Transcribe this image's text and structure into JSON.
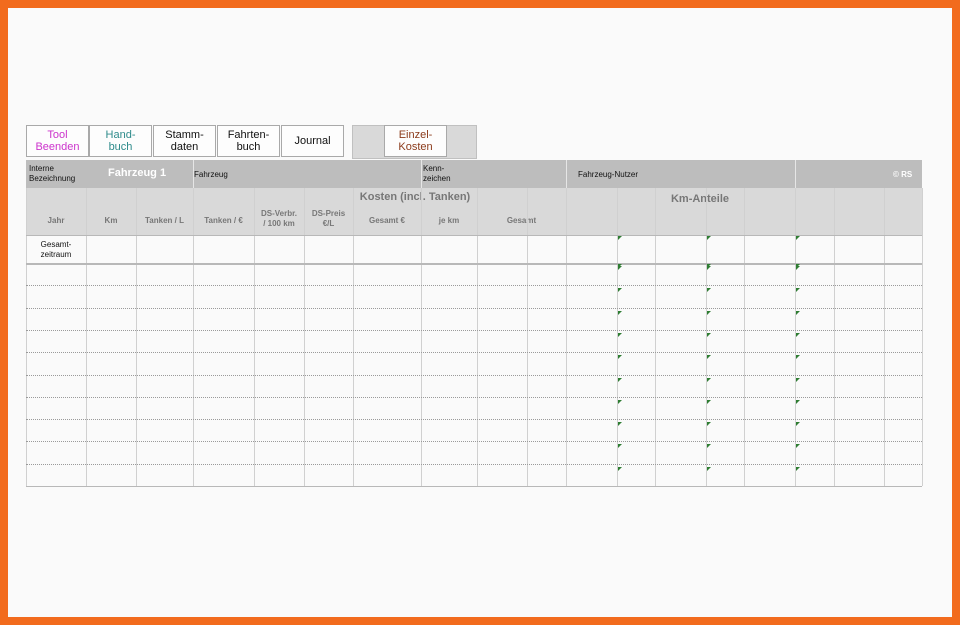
{
  "toolbar": {
    "tool_beenden": "Tool\nBeenden",
    "handbuch": "Hand-\nbuch",
    "stammdaten": "Stamm-\ndaten",
    "fahrtenbuch": "Fahrten-\nbuch",
    "journal": "Journal",
    "einzelkosten": "Einzel-\nKosten"
  },
  "colors": {
    "frame": "#f26b1d",
    "tool_beenden": "#cc33cc",
    "handbuch": "#2e8b8b",
    "einzelkosten": "#8b3a1a",
    "header_dark": "#bdbdbd",
    "header_light": "#d9d9d9",
    "marker": "#2e7d32"
  },
  "header": {
    "interne_bezeichnung": "Interne\nBezeichnung",
    "fahrzeug_name": "Fahrzeug 1",
    "fahrzeug": "Fahrzeug",
    "kennzeichen": "Kenn-\nzeichen",
    "fahrzeug_nutzer": "Fahrzeug-Nutzer",
    "copyright": "© RS"
  },
  "columns": {
    "kosten_group": "Kosten (incl. Tanken)",
    "km_anteile_group": "Km-Anteile",
    "jahr": "Jahr",
    "km": "Km",
    "tanken_l": "Tanken / L",
    "tanken_eur": "Tanken / €",
    "ds_verbr": "DS-Verbr.\n/ 100 km",
    "ds_preis": "DS-Preis\n€/L",
    "gesamt_eur": "Gesamt €",
    "je_km": "je km",
    "gesamt": "Gesamt"
  },
  "summary_row": {
    "label": "Gesamt-\nzeitraum"
  }
}
